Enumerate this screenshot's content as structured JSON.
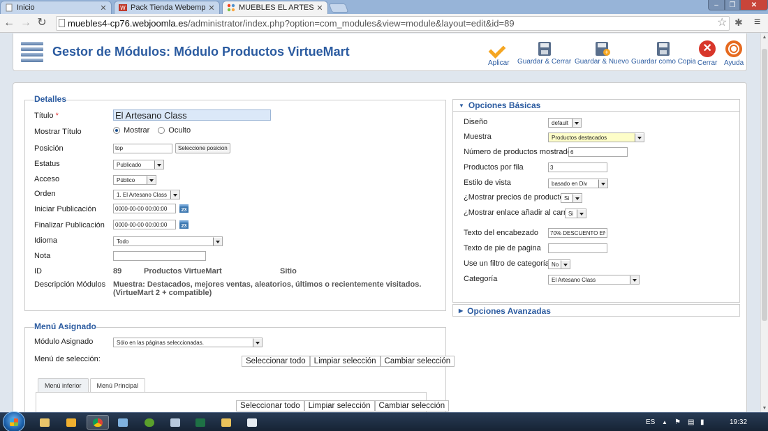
{
  "browser": {
    "tabs": [
      {
        "title": "Inicio",
        "active": false
      },
      {
        "title": "Pack Tienda Webempresa",
        "active": false
      },
      {
        "title": "MUEBLES EL ARTESANO -",
        "active": true
      }
    ],
    "url_host": "muebles4-cp76.webjoomla.es",
    "url_path": "/administrator/index.php?option=com_modules&view=module&layout=edit&id=89"
  },
  "header": {
    "title": "Gestor de Módulos: Módulo Productos VirtueMart",
    "toolbar": {
      "apply": "Aplicar",
      "save_close": "Guardar & Cerrar",
      "save_new": "Guardar & Nuevo",
      "save_copy": "Guardar como Copia",
      "close": "Cerrar",
      "help": "Ayuda"
    }
  },
  "details": {
    "legend": "Detalles",
    "title_label": "Título",
    "title_value": "El Artesano Class",
    "show_title_label": "Mostrar Título",
    "show_option": "Mostrar",
    "hide_option": "Oculto",
    "position_label": "Posición",
    "position_value": "top",
    "position_button": "Seleccione posicion",
    "status_label": "Estatus",
    "status_value": "Publicado",
    "access_label": "Acceso",
    "access_value": "Público",
    "order_label": "Orden",
    "order_value": "1. El Artesano Class",
    "start_label": "Iniciar Publicación",
    "start_value": "0000-00-00 00:00:00",
    "finish_label": "Finalizar Publicación",
    "finish_value": "0000-00-00 00:00:00",
    "calendar_day": "23",
    "language_label": "Idioma",
    "language_value": "Todo",
    "note_label": "Nota",
    "note_value": "",
    "id_label": "ID",
    "id_value": "89",
    "module_name": "Productos VirtueMart",
    "site": "Sitio",
    "desc_label": "Descripción Módulos",
    "desc_line1": "Muestra: Destacados, mejores ventas, aleatorios, últimos o recientemente visitados.",
    "desc_line2": "(VirtueMart 2 + compatible)"
  },
  "menu_assign": {
    "legend": "Menú Asignado",
    "module_label": "Módulo Asignado",
    "module_value": "Sólo en las páginas seleccionadas.",
    "selection_label": "Menú de selección:",
    "select_all": "Seleccionar todo",
    "clear": "Limpiar selección",
    "toggle": "Cambiar selección",
    "tabs": [
      "Menú inferior",
      "Menú Principal"
    ]
  },
  "basic_options": {
    "heading": "Opciones Básicas",
    "layout_label": "Diseño",
    "layout_value": "default",
    "show_label": "Muestra",
    "show_value": "Productos destacados",
    "count_label": "Número de productos mostrados",
    "count_value": "6",
    "per_row_label": "Productos por fila",
    "per_row_value": "3",
    "view_label": "Estilo de vista",
    "view_value": "basado en Div",
    "prices_label": "¿Mostrar precios de producto?",
    "prices_value": "Si",
    "cart_label": "¿Mostrar enlace añadir al carro?",
    "cart_value": "Si",
    "header_text_label": "Texto del encabezado",
    "header_text_value": "70% DESCUENTO EN",
    "footer_text_label": "Texto de pie de pagina",
    "footer_text_value": "",
    "filter_label": "Use un filtro de categoría",
    "filter_value": "No",
    "category_label": "Categoría",
    "category_value": "El Artesano Class"
  },
  "advanced_options": {
    "heading": "Opciones Avanzadas"
  },
  "taskbar": {
    "language": "ES",
    "time": "19:32"
  },
  "colors": {
    "accent": "#2b5ba0",
    "apply_icon": "#f5a622",
    "close_icon": "#d8362a"
  }
}
